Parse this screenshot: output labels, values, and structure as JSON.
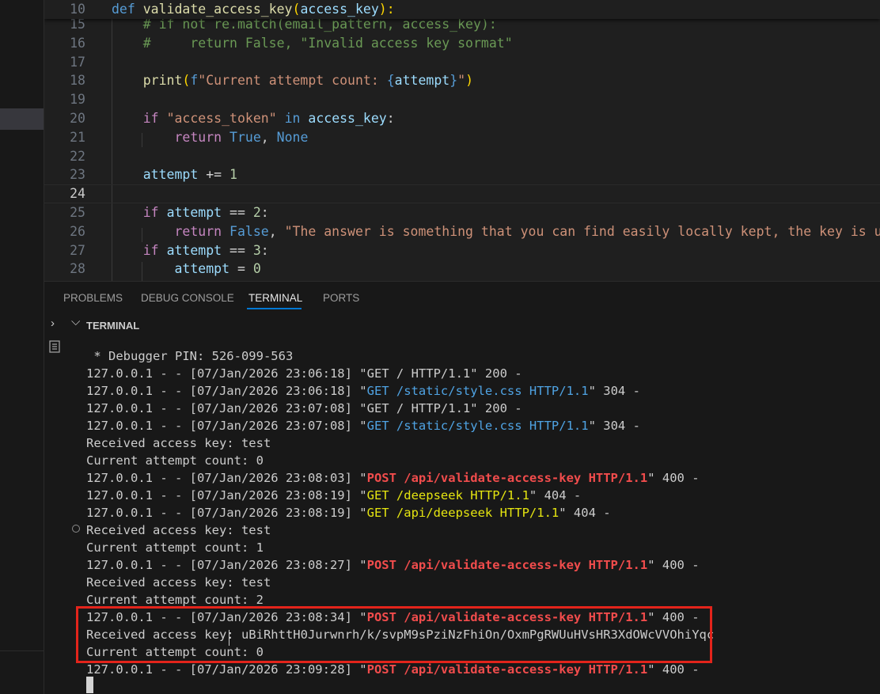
{
  "editor": {
    "lines": [
      {
        "num": "10",
        "sticky": true,
        "tokens": [
          {
            "t": "def ",
            "c": "#569cd6"
          },
          {
            "t": "validate_access_key",
            "c": "#dcdcaa"
          },
          {
            "t": "(",
            "c": "#ffd700"
          },
          {
            "t": "access_key",
            "c": "#9cdcfe"
          },
          {
            "t": "):",
            "c": "#ffd700"
          }
        ]
      },
      {
        "num": "15",
        "tokens": [
          {
            "t": "    # if not re.match(email_pattern, access_key):",
            "c": "#6a9955"
          }
        ]
      },
      {
        "num": "16",
        "tokens": [
          {
            "t": "    #     return False, \"Invalid access key sormat\"",
            "c": "#6a9955"
          }
        ]
      },
      {
        "num": "17",
        "tokens": []
      },
      {
        "num": "18",
        "tokens": [
          {
            "t": "    ",
            "c": "#cccccc"
          },
          {
            "t": "print",
            "c": "#dcdcaa"
          },
          {
            "t": "(",
            "c": "#ffd700"
          },
          {
            "t": "f",
            "c": "#569cd6"
          },
          {
            "t": "\"Current attempt count: ",
            "c": "#ce9178"
          },
          {
            "t": "{",
            "c": "#569cd6"
          },
          {
            "t": "attempt",
            "c": "#9cdcfe"
          },
          {
            "t": "}",
            "c": "#569cd6"
          },
          {
            "t": "\"",
            "c": "#ce9178"
          },
          {
            "t": ")",
            "c": "#ffd700"
          }
        ]
      },
      {
        "num": "19",
        "tokens": []
      },
      {
        "num": "20",
        "tokens": [
          {
            "t": "    ",
            "c": "#cccccc"
          },
          {
            "t": "if ",
            "c": "#c586c0"
          },
          {
            "t": "\"access_token\"",
            "c": "#ce9178"
          },
          {
            "t": " in ",
            "c": "#569cd6"
          },
          {
            "t": "access_key",
            "c": "#9cdcfe"
          },
          {
            "t": ":",
            "c": "#cccccc"
          }
        ]
      },
      {
        "num": "21",
        "tokens": [
          {
            "t": "        ",
            "c": "#cccccc"
          },
          {
            "t": "return ",
            "c": "#c586c0"
          },
          {
            "t": "True",
            "c": "#569cd6"
          },
          {
            "t": ", ",
            "c": "#cccccc"
          },
          {
            "t": "None",
            "c": "#569cd6"
          }
        ]
      },
      {
        "num": "22",
        "tokens": []
      },
      {
        "num": "23",
        "tokens": [
          {
            "t": "    ",
            "c": "#cccccc"
          },
          {
            "t": "attempt",
            "c": "#9cdcfe"
          },
          {
            "t": " += ",
            "c": "#d4d4d4"
          },
          {
            "t": "1",
            "c": "#b5cea8"
          }
        ]
      },
      {
        "num": "24",
        "current": true,
        "tokens": []
      },
      {
        "num": "25",
        "tokens": [
          {
            "t": "    ",
            "c": "#cccccc"
          },
          {
            "t": "if ",
            "c": "#c586c0"
          },
          {
            "t": "attempt",
            "c": "#9cdcfe"
          },
          {
            "t": " == ",
            "c": "#d4d4d4"
          },
          {
            "t": "2",
            "c": "#b5cea8"
          },
          {
            "t": ":",
            "c": "#cccccc"
          }
        ]
      },
      {
        "num": "26",
        "tokens": [
          {
            "t": "        ",
            "c": "#cccccc"
          },
          {
            "t": "return ",
            "c": "#c586c0"
          },
          {
            "t": "False",
            "c": "#569cd6"
          },
          {
            "t": ", ",
            "c": "#cccccc"
          },
          {
            "t": "\"The answer is something that you can find easily locally kept, the key is u$er",
            "c": "#ce9178"
          }
        ]
      },
      {
        "num": "27",
        "tokens": [
          {
            "t": "    ",
            "c": "#cccccc"
          },
          {
            "t": "if ",
            "c": "#c586c0"
          },
          {
            "t": "attempt",
            "c": "#9cdcfe"
          },
          {
            "t": " == ",
            "c": "#d4d4d4"
          },
          {
            "t": "3",
            "c": "#b5cea8"
          },
          {
            "t": ":",
            "c": "#cccccc"
          }
        ]
      },
      {
        "num": "28",
        "tokens": [
          {
            "t": "        ",
            "c": "#cccccc"
          },
          {
            "t": "attempt",
            "c": "#9cdcfe"
          },
          {
            "t": " = ",
            "c": "#d4d4d4"
          },
          {
            "t": "0",
            "c": "#b5cea8"
          }
        ]
      }
    ]
  },
  "panel": {
    "tabs": [
      "PROBLEMS",
      "DEBUG CONSOLE",
      "TERMINAL",
      "PORTS"
    ],
    "active_tab": "TERMINAL",
    "section_title": "TERMINAL"
  },
  "terminal": {
    "lines": [
      [
        {
          "t": " * Debugger PIN: 526-099-563"
        }
      ],
      [
        {
          "t": "127.0.0.1 - - [07/Jan/2026 23:06:18] \"GET / HTTP/1.1\" 200 -"
        }
      ],
      [
        {
          "t": "127.0.0.1 - - [07/Jan/2026 23:06:18] \""
        },
        {
          "t": "GET /static/style.css HTTP/1.1",
          "s": "blue"
        },
        {
          "t": "\" 304 -"
        }
      ],
      [
        {
          "t": "127.0.0.1 - - [07/Jan/2026 23:07:08] \"GET / HTTP/1.1\" 200 -"
        }
      ],
      [
        {
          "t": "127.0.0.1 - - [07/Jan/2026 23:07:08] \""
        },
        {
          "t": "GET /static/style.css HTTP/1.1",
          "s": "blue"
        },
        {
          "t": "\" 304 -"
        }
      ],
      [
        {
          "t": "Received access key: test"
        }
      ],
      [
        {
          "t": "Current attempt count: 0"
        }
      ],
      [
        {
          "t": "127.0.0.1 - - [07/Jan/2026 23:08:03] \""
        },
        {
          "t": "POST /api/validate-access-key HTTP/1.1",
          "s": "red"
        },
        {
          "t": "\" 400 -"
        }
      ],
      [
        {
          "t": "127.0.0.1 - - [07/Jan/2026 23:08:19] \""
        },
        {
          "t": "GET /deepseek HTTP/1.1",
          "s": "yellow"
        },
        {
          "t": "\" 404 -"
        }
      ],
      [
        {
          "t": "127.0.0.1 - - [07/Jan/2026 23:08:19] \""
        },
        {
          "t": "GET /api/deepseek HTTP/1.1",
          "s": "yellow"
        },
        {
          "t": "\" 404 -"
        }
      ],
      [
        {
          "t": "Received access key: test"
        }
      ],
      [
        {
          "t": "Current attempt count: 1"
        }
      ],
      [
        {
          "t": "127.0.0.1 - - [07/Jan/2026 23:08:27] \""
        },
        {
          "t": "POST /api/validate-access-key HTTP/1.1",
          "s": "red"
        },
        {
          "t": "\" 400 -"
        }
      ],
      [
        {
          "t": "Received access key: test"
        }
      ],
      [
        {
          "t": "Current attempt count: 2"
        }
      ],
      [
        {
          "t": "127.0.0.1 - - [07/Jan/2026 23:08:34] \""
        },
        {
          "t": "POST /api/validate-access-key HTTP/1.1",
          "s": "red"
        },
        {
          "t": "\" 400 -"
        }
      ],
      [
        {
          "t": "Received access key: uBiRhttH0Jurwnrh/k/svpM9sPziNzFhiOn/OxmPgRWUuHVsHR3XdOWcVVOhiYqc"
        }
      ],
      [
        {
          "t": "Current attempt count: 0"
        }
      ],
      [
        {
          "t": "127.0.0.1 - - [07/Jan/2026 23:09:28] \""
        },
        {
          "t": "POST /api/validate-access-key HTTP/1.1",
          "s": "red"
        },
        {
          "t": "\" 400 -"
        }
      ]
    ]
  },
  "colors": {
    "accent": "#0078d4",
    "highlight_box": "#e3241b",
    "error_red": "#f14c4c",
    "link_blue": "#4fa3e3",
    "warn_yellow": "#e5e510"
  }
}
